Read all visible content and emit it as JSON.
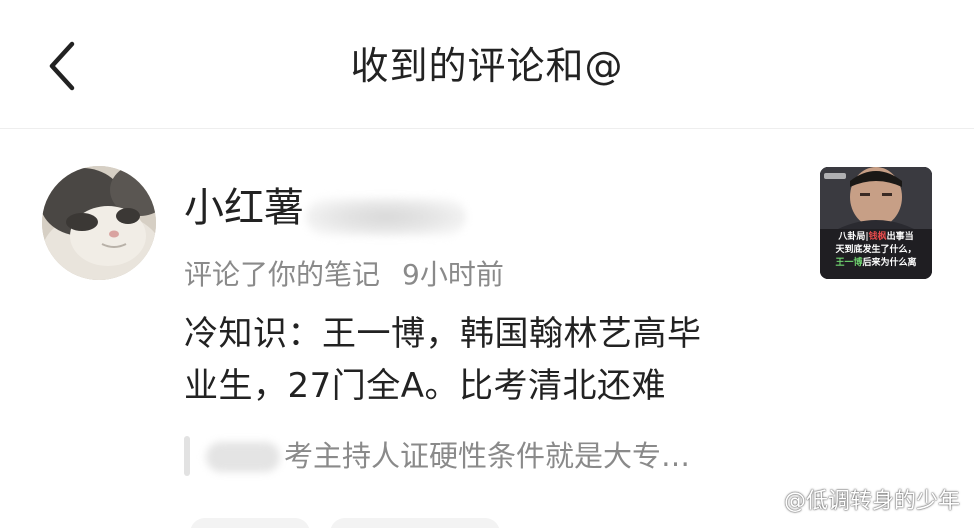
{
  "header": {
    "title": "收到的评论和@"
  },
  "notification": {
    "username_visible": "小红薯",
    "action": "评论了你的笔记",
    "time": "9小时前",
    "comment_lines": [
      "冷知识：王一博，韩国翰林艺高毕",
      "业生，27门全A。比考清北还难"
    ],
    "quoted_text": "考主持人证硬性条件就是大专…",
    "thumbnail": {
      "caption_lines": [
        {
          "prefix": "八卦局|",
          "highlight": "钱枫",
          "suffix": "出事当"
        },
        {
          "prefix": "天到底发生了什么，",
          "highlight": "",
          "suffix": ""
        },
        {
          "prefix": "",
          "highlight": "王一博",
          "suffix": "后来为什么离"
        }
      ]
    }
  },
  "watermark": {
    "text": "@低调转身的少年"
  }
}
